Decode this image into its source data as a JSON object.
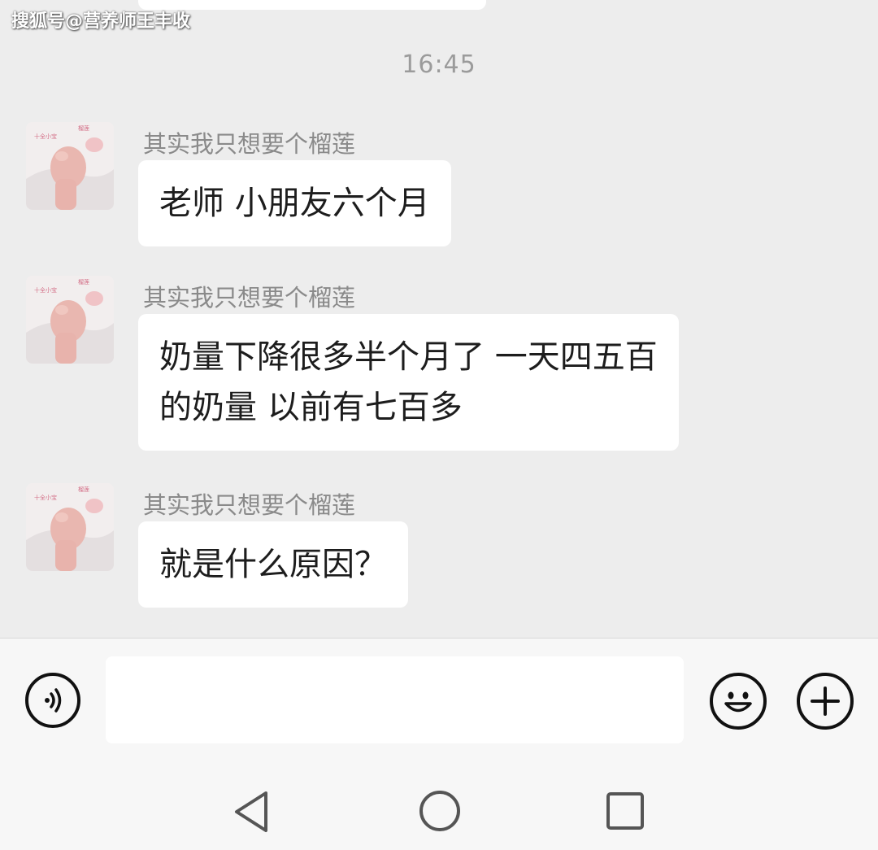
{
  "watermark": "搜狐号@营养师王丰收",
  "chat": {
    "timestamp": "16:45",
    "messages": [
      {
        "sender": "其实我只想要个榴莲",
        "lines": [
          "老师  小朋友六个月"
        ]
      },
      {
        "sender": "其实我只想要个榴莲",
        "lines": [
          "奶量下降很多半个月了 一天四五百",
          "的奶量 以前有七百多"
        ]
      },
      {
        "sender": "其实我只想要个榴莲",
        "lines": [
          "就是什么原因？"
        ]
      }
    ]
  },
  "input_bar": {
    "voice_icon": "voice-icon",
    "message_value": "",
    "emoji_icon": "emoji-icon",
    "more_icon": "plus-icon"
  },
  "nav": {
    "back_icon": "triangle-back-icon",
    "home_icon": "circle-home-icon",
    "recents_icon": "square-recents-icon"
  },
  "colors": {
    "chat_background": "#ededed",
    "bubble": "#ffffff",
    "input_bar": "#f7f7f7"
  }
}
